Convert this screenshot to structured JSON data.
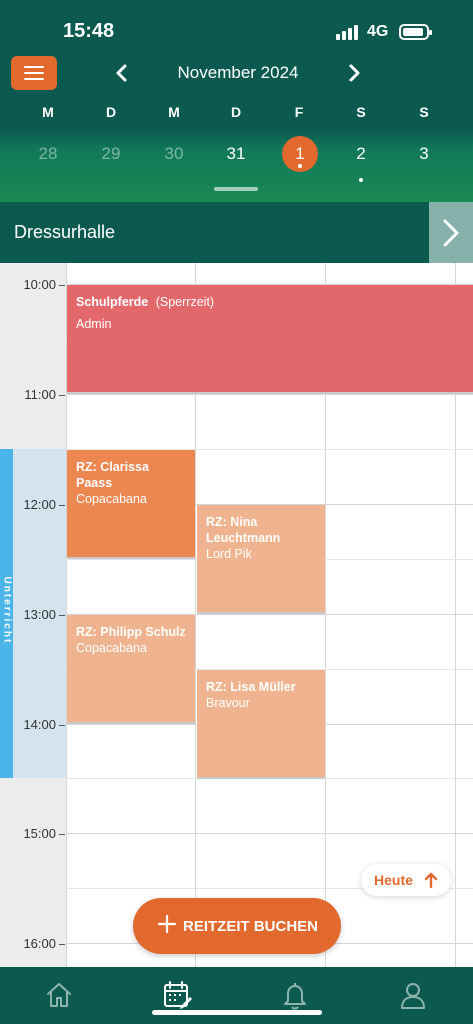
{
  "status_bar": {
    "time": "15:48",
    "network": "4G"
  },
  "header": {
    "month_label": "November 2024",
    "prev_icon": "chevron-left-icon",
    "next_icon": "chevron-right-icon",
    "menu_icon": "hamburger-icon",
    "weekdays": [
      "M",
      "D",
      "M",
      "D",
      "F",
      "S",
      "S"
    ],
    "days": [
      {
        "num": "28",
        "state": "dim",
        "has_events": false
      },
      {
        "num": "29",
        "state": "dim",
        "has_events": false
      },
      {
        "num": "30",
        "state": "dim",
        "has_events": false
      },
      {
        "num": "31",
        "state": "bright",
        "has_events": false
      },
      {
        "num": "1",
        "state": "selected",
        "has_events": true
      },
      {
        "num": "2",
        "state": "bright",
        "has_events": true
      },
      {
        "num": "3",
        "state": "bright",
        "has_events": false
      }
    ],
    "selected_color": "#e2692e"
  },
  "resource": {
    "name": "Dressurhalle",
    "next_icon": "chevron-right-icon"
  },
  "calendar": {
    "hours": [
      "10:00",
      "11:00",
      "12:00",
      "13:00",
      "14:00",
      "15:00",
      "16:00"
    ],
    "lesson_band_label": "Unterricht",
    "events": [
      {
        "title": "Schulpferde",
        "tag": "(Sperrzeit)",
        "subtitle": "Admin",
        "kind": "block"
      },
      {
        "title": "RZ: Clarissa Paass",
        "subtitle": "Copacabana",
        "kind": "orange"
      },
      {
        "title": "RZ: Nina Leuchtmann",
        "subtitle": "Lord Pik",
        "kind": "light"
      },
      {
        "title": "RZ: Philipp Schulz",
        "subtitle": "Copacabana",
        "kind": "light"
      },
      {
        "title": "RZ: Lisa Müller",
        "subtitle": "Bravour",
        "kind": "light"
      }
    ],
    "colors": {
      "block": "#e3686c",
      "orange": "#ec8752",
      "light": "#efb48f",
      "lesson_strip": "#4bb5e9"
    }
  },
  "actions": {
    "today_label": "Heute",
    "book_label": "REITZEIT BUCHEN"
  },
  "tabbar": {
    "tabs": [
      "home-icon",
      "calendar-edit-icon",
      "bell-icon",
      "user-icon"
    ],
    "active": "calendar-edit-icon"
  },
  "theme": {
    "primary": "#0c5a4f",
    "accent": "#e2692e"
  }
}
